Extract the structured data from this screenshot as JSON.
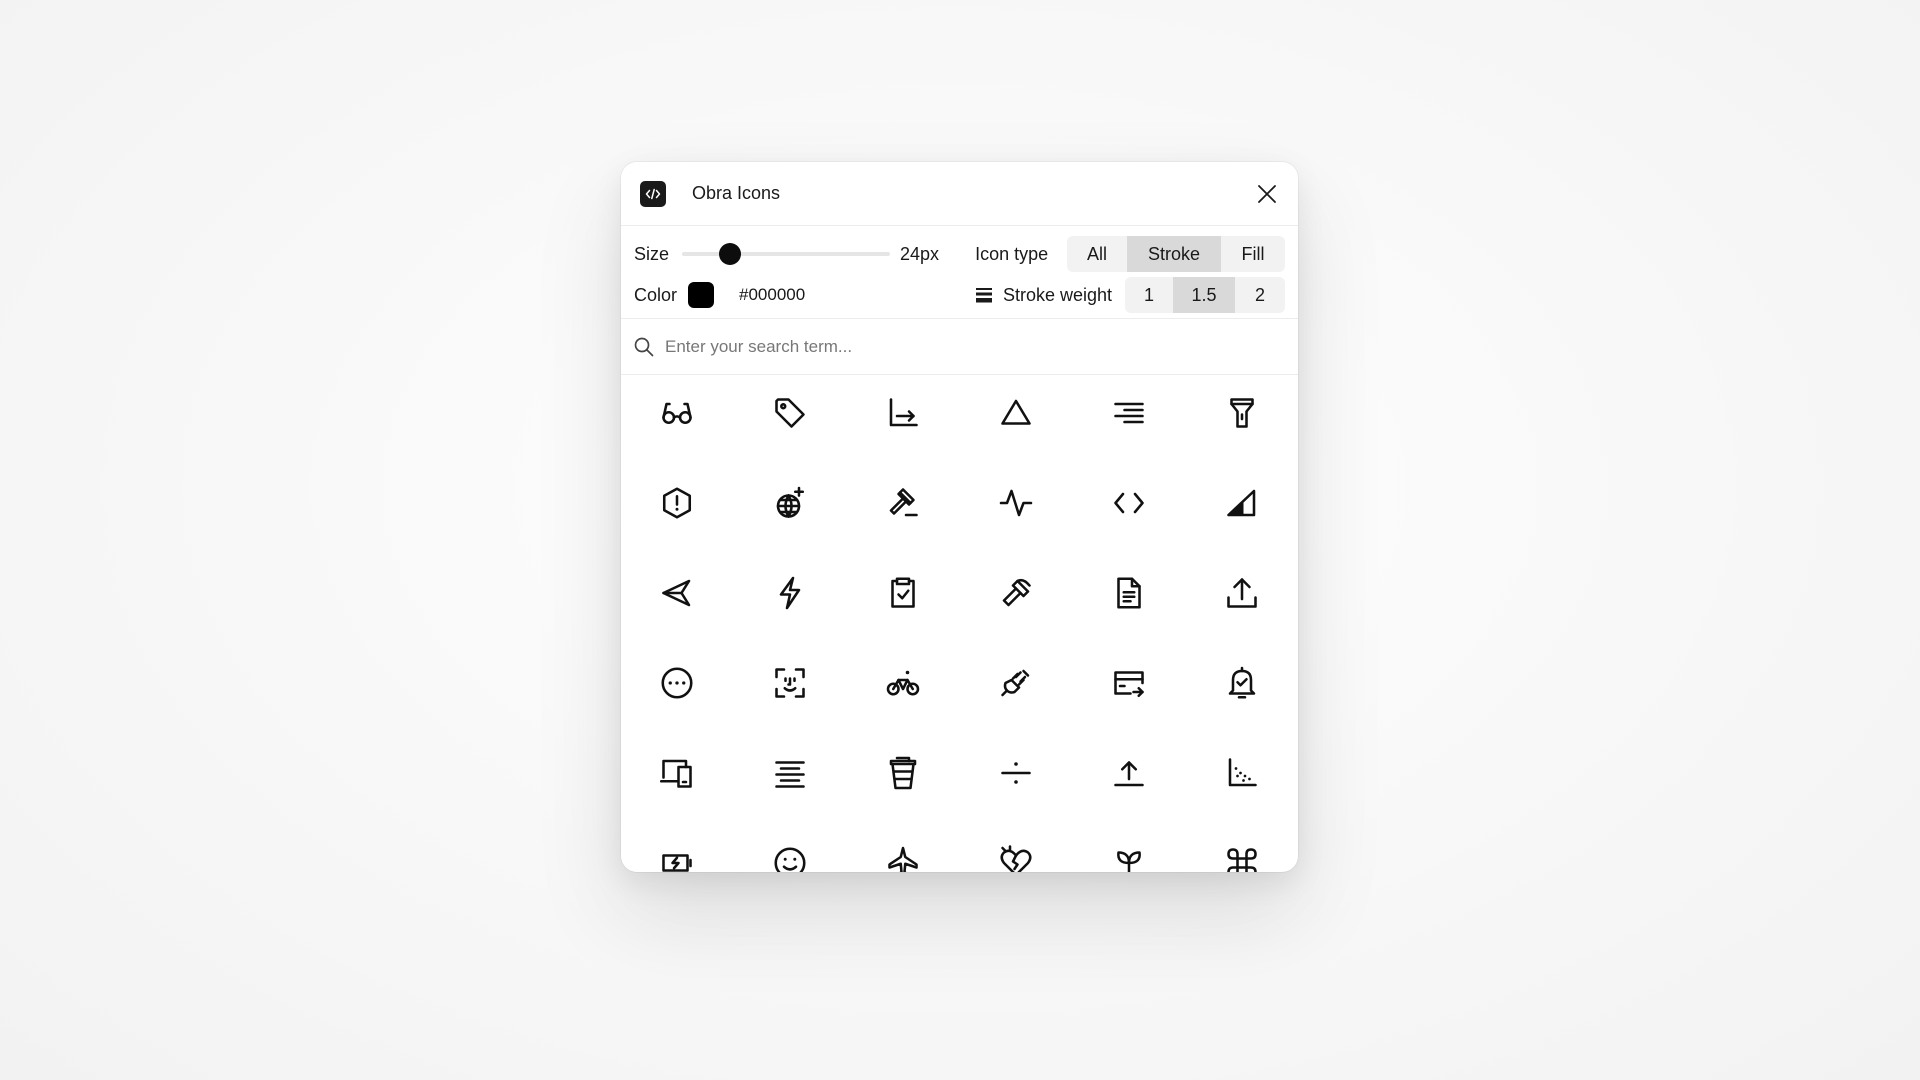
{
  "app": {
    "title": "Obra Icons"
  },
  "controls": {
    "size_label": "Size",
    "size_value": "24px",
    "size_fraction": 0.2,
    "icon_type_label": "Icon type",
    "icon_types": [
      {
        "label": "All",
        "active": false
      },
      {
        "label": "Stroke",
        "active": true
      },
      {
        "label": "Fill",
        "active": false
      }
    ],
    "color_label": "Color",
    "color_value": "#000000",
    "stroke_weight_label": "Stroke weight",
    "stroke_weights": [
      {
        "label": "1",
        "active": false
      },
      {
        "label": "1.5",
        "active": true
      },
      {
        "label": "2",
        "active": false
      }
    ]
  },
  "search": {
    "placeholder": "Enter your search term..."
  },
  "icons": [
    [
      "glasses-icon",
      "tag-icon",
      "chart-axis-arrow-icon",
      "triangle-icon",
      "align-right-icon",
      "flashlight-icon"
    ],
    [
      "hexagon-alert-icon",
      "globe-sparkle-icon",
      "gavel-icon",
      "activity-icon",
      "code-icon",
      "signal-icon"
    ],
    [
      "send-left-icon",
      "lightning-icon",
      "clipboard-check-icon",
      "axe-icon",
      "document-text-icon",
      "upload-icon"
    ],
    [
      "more-circle-icon",
      "face-scan-icon",
      "bicycle-icon",
      "plug-icon",
      "card-transfer-icon",
      "bell-check-icon"
    ],
    [
      "devices-icon",
      "text-align-center-icon",
      "cup-icon",
      "divide-icon",
      "upload-line-icon",
      "chart-dots-icon"
    ],
    [
      "battery-charge-icon",
      "smiley-icon",
      "plane-icon",
      "heart-broken-icon",
      "plant-icon",
      "command-icon"
    ]
  ]
}
